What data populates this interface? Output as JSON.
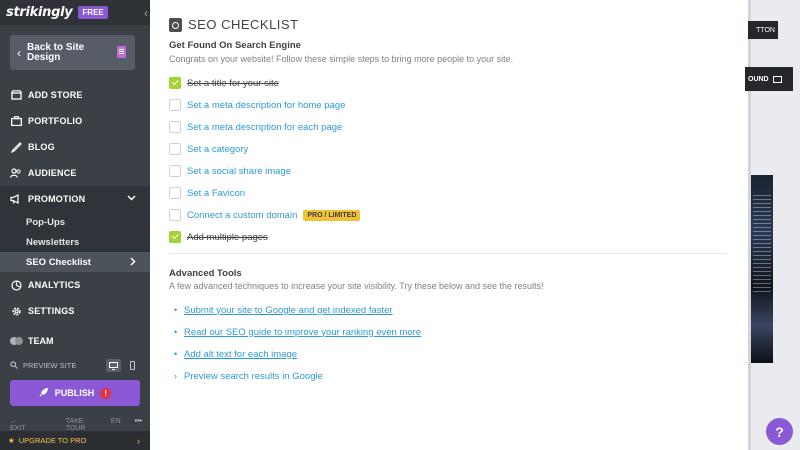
{
  "brand": {
    "logo": "strikingly",
    "plan_badge": "FREE"
  },
  "back_button": {
    "label": "Back to Site Design"
  },
  "nav": {
    "items": [
      {
        "label": "ADD STORE",
        "icon": "store-icon"
      },
      {
        "label": "PORTFOLIO",
        "icon": "portfolio-icon"
      },
      {
        "label": "BLOG",
        "icon": "blog-icon"
      },
      {
        "label": "AUDIENCE",
        "icon": "audience-icon"
      },
      {
        "label": "PROMOTION",
        "icon": "megaphone-icon"
      },
      {
        "label": "ANALYTICS",
        "icon": "analytics-icon"
      },
      {
        "label": "SETTINGS",
        "icon": "gear-icon"
      }
    ],
    "promotion_sub": [
      "Pop-Ups",
      "Newsletters",
      "SEO Checklist"
    ]
  },
  "team": {
    "label": "TEAM"
  },
  "preview": {
    "label": "PREVIEW SITE"
  },
  "publish": {
    "label": "PUBLISH",
    "alert": "!"
  },
  "footer": {
    "exit": "EXIT",
    "tour": "TAKE TOUR",
    "lang": "EN",
    "more": "•••"
  },
  "upgrade": {
    "label": "UPGRADE TO PRO"
  },
  "modal": {
    "title": "SEO CHECKLIST",
    "section1_title": "Get Found On Search Engine",
    "section1_sub": "Congrats on your website! Follow these simple steps to bring more people to your site.",
    "checklist": [
      {
        "label": "Set a title for your site",
        "done": true
      },
      {
        "label": "Set a meta description for home page",
        "done": false
      },
      {
        "label": "Set a meta description for each page",
        "done": false
      },
      {
        "label": "Set a category",
        "done": false
      },
      {
        "label": "Set a social share image",
        "done": false
      },
      {
        "label": "Set a Favicon",
        "done": false
      },
      {
        "label": "Connect a custom domain",
        "done": false,
        "badge": "PRO / LIMITED"
      },
      {
        "label": "Add multiple pages",
        "done": true
      }
    ],
    "section2_title": "Advanced Tools",
    "section2_sub": "A few advanced techniques to increase your site visibility. Try these below and see the results!",
    "tools": [
      "Submit your site to Google and get indexed faster",
      "Read our SEO guide to improve your ranking even more",
      "Add alt text for each image",
      "Preview search results in Google"
    ]
  },
  "background": {
    "btn1": "TTON",
    "btn2": "OUND"
  },
  "help": {
    "label": "?"
  },
  "colors": {
    "accent": "#8c59d6",
    "check": "#a4d233",
    "link": "#2d9bd6",
    "pro": "#f1c232"
  }
}
